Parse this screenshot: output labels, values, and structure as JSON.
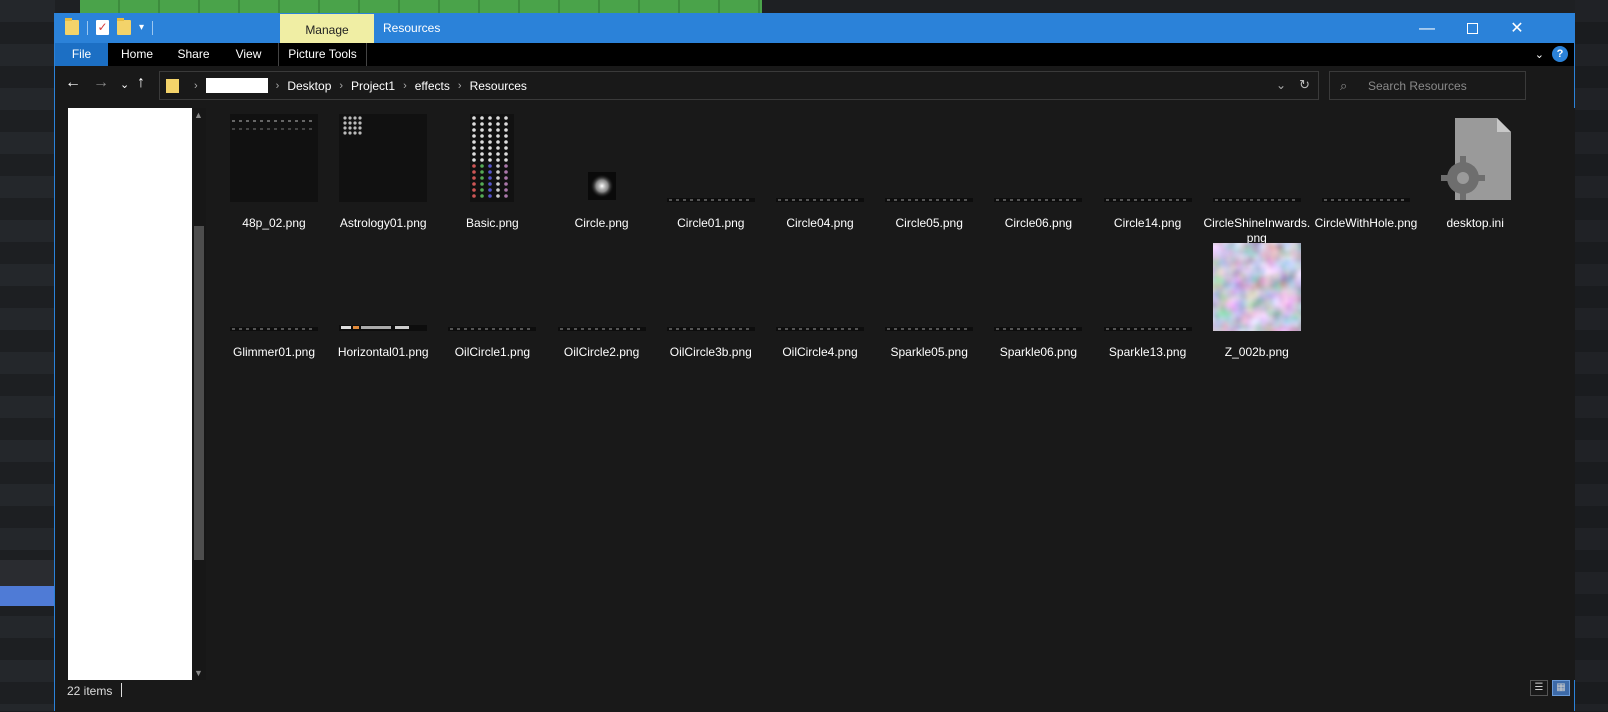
{
  "titlebar": {
    "title": "Resources",
    "manage_label": "Manage"
  },
  "ribbon": {
    "file": "File",
    "home": "Home",
    "share": "Share",
    "view": "View",
    "picture_tools": "Picture Tools"
  },
  "address": {
    "crumbs": [
      "Desktop",
      "Project1",
      "effects",
      "Resources"
    ]
  },
  "search": {
    "placeholder": "Search Resources"
  },
  "files": [
    {
      "name": "48p_02.png",
      "thumb": "sprite-row"
    },
    {
      "name": "Astrology01.png",
      "thumb": "glyph-grid"
    },
    {
      "name": "Basic.png",
      "thumb": "shapes-column"
    },
    {
      "name": "Circle.png",
      "thumb": "glow"
    },
    {
      "name": "Circle01.png",
      "thumb": "strip"
    },
    {
      "name": "Circle04.png",
      "thumb": "strip"
    },
    {
      "name": "Circle05.png",
      "thumb": "strip"
    },
    {
      "name": "Circle06.png",
      "thumb": "strip"
    },
    {
      "name": "Circle14.png",
      "thumb": "strip"
    },
    {
      "name": "CircleShineInwards.png",
      "thumb": "strip"
    },
    {
      "name": "CircleWithHole.png",
      "thumb": "strip"
    },
    {
      "name": "desktop.ini",
      "thumb": "settings-file"
    },
    {
      "name": "Glimmer01.png",
      "thumb": "strip"
    },
    {
      "name": "Horizontal01.png",
      "thumb": "strip-bright"
    },
    {
      "name": "OilCircle1.png",
      "thumb": "strip"
    },
    {
      "name": "OilCircle2.png",
      "thumb": "strip"
    },
    {
      "name": "OilCircle3b.png",
      "thumb": "strip"
    },
    {
      "name": "OilCircle4.png",
      "thumb": "strip"
    },
    {
      "name": "Sparkle05.png",
      "thumb": "strip"
    },
    {
      "name": "Sparkle06.png",
      "thumb": "strip"
    },
    {
      "name": "Sparkle13.png",
      "thumb": "strip"
    },
    {
      "name": "Z_002b.png",
      "thumb": "noise-texture"
    }
  ],
  "status": {
    "count": "22 items"
  },
  "colors": {
    "accent": "#2b82d9",
    "manage_tab": "#f0eea4",
    "background": "#191919"
  }
}
